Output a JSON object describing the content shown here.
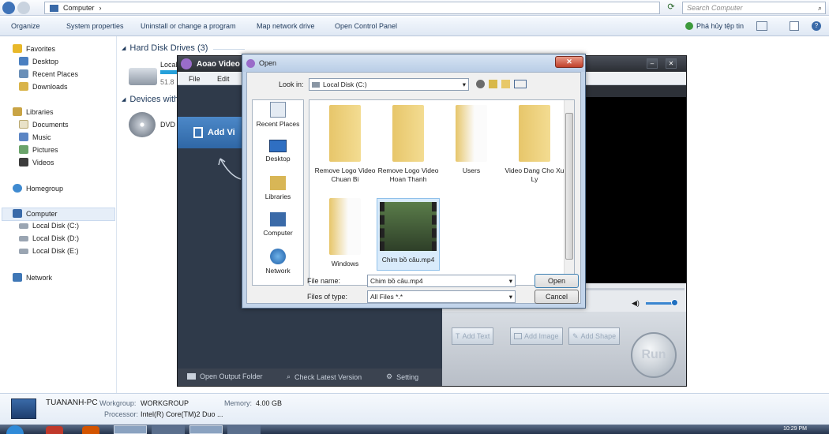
{
  "explorer": {
    "address_path": "Computer",
    "search_placeholder": "Search Computer",
    "toolbar": [
      "Organize",
      "System properties",
      "Uninstall or change a program",
      "Map network drive",
      "Open Control Panel"
    ],
    "toolbar_right_label": "Phá hủy tệp tin",
    "sidebar": {
      "favorites": "Favorites",
      "favorites_items": [
        "Desktop",
        "Recent Places",
        "Downloads"
      ],
      "libraries": "Libraries",
      "libraries_items": [
        "Documents",
        "Music",
        "Pictures",
        "Videos"
      ],
      "homegroup": "Homegroup",
      "computer": "Computer",
      "computer_items": [
        "Local Disk (C:)",
        "Local Disk (D:)",
        "Local Disk (E:)"
      ],
      "network": "Network"
    },
    "main": {
      "hard_disk_header": "Hard Disk Drives (3)",
      "devices_header": "Devices with",
      "drive_local_label": "Local",
      "drive_local_size": "51.8",
      "drive_dvd_label": "DVD"
    },
    "details": {
      "pc_name": "TUANANH-PC",
      "workgroup_label": "Workgroup:",
      "workgroup_value": "WORKGROUP",
      "memory_label": "Memory:",
      "memory_value": "4.00 GB",
      "processor_label": "Processor:",
      "processor_value": "Intel(R) Core(TM)2 Duo ..."
    },
    "clock": "10:29 PM"
  },
  "app": {
    "title": "Aoao Video",
    "menu": [
      "File",
      "Edit"
    ],
    "add_video": "Add Vi",
    "bottom": [
      "Open Output Folder",
      "Check Latest Version",
      "Setting"
    ],
    "edit_buttons": [
      "Add Text",
      "Add Image",
      "Add Shape"
    ],
    "run": "Run"
  },
  "dialog": {
    "title": "Open",
    "look_in_label": "Look in:",
    "look_in_value": "Local Disk (C:)",
    "places": [
      "Recent Places",
      "Desktop",
      "Libraries",
      "Computer",
      "Network"
    ],
    "files": [
      {
        "name": "Remove Logo Video Chuan Bi"
      },
      {
        "name": "Remove Logo Video Hoan Thanh"
      },
      {
        "name": "Users"
      },
      {
        "name": "Video Dang Cho Xu Ly"
      },
      {
        "name": "Windows"
      },
      {
        "name": "Chim bồ câu.mp4"
      }
    ],
    "file_name_label": "File name:",
    "file_name_value": "Chim bồ câu.mp4",
    "files_of_type_label": "Files of type:",
    "files_of_type_value": "All Files *.*",
    "open_button": "Open",
    "cancel_button": "Cancel"
  },
  "colors": {
    "accent": "#2f67a6",
    "folder": "#e8c868",
    "dialog_frame": "#c2d4ea"
  }
}
